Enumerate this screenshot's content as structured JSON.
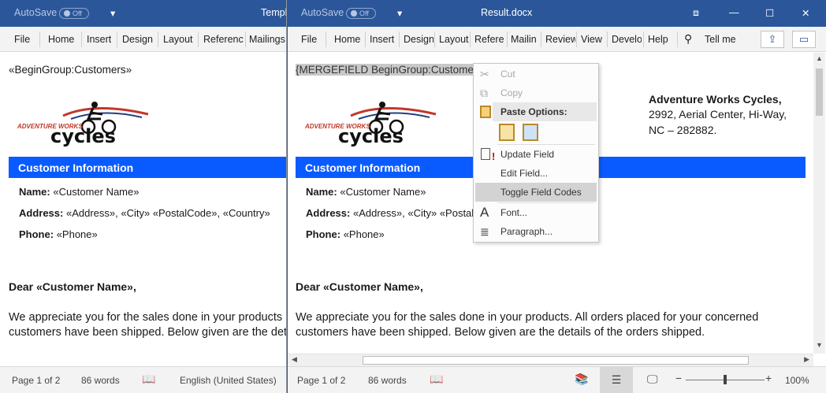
{
  "left_window": {
    "autosave_label": "AutoSave",
    "autosave_state": "Off",
    "title": "Templ",
    "menu": [
      "File",
      "Home",
      "Insert",
      "Design",
      "Layout",
      "Referenc",
      "Mailings"
    ],
    "document": {
      "begin_group": "«BeginGroup:Customers»",
      "logo_top": "ADVENTURE WORKS",
      "logo_bottom": "cycles",
      "section_title": "Customer Information",
      "name_label": "Name:",
      "name_value": "«Customer Name»",
      "address_label": "Address:",
      "address_value": "«Address», «City» «PostalCode», «Country»",
      "phone_label": "Phone:",
      "phone_value": "«Phone»",
      "greeting": "Dear «Customer Name»,",
      "body_line1": "We appreciate you for the sales done in your products",
      "body_line2": "customers have been shipped. Below given are the det"
    },
    "status": {
      "page": "Page 1 of 2",
      "words": "86 words",
      "language": "English (United States)"
    }
  },
  "right_window": {
    "autosave_label": "AutoSave",
    "autosave_state": "Off",
    "title": "Result.docx",
    "menu": [
      "File",
      "Home",
      "Insert",
      "Design",
      "Layout",
      "Refere",
      "Mailin",
      "Review",
      "View",
      "Develo",
      "Help"
    ],
    "tell_me": "Tell me",
    "document": {
      "merge_field": "{MERGEFIELD BeginGroup:Customers",
      "logo_top": "ADVENTURE WORKS",
      "logo_bottom": "cycles",
      "company_name": "Adventure Works Cycles,",
      "company_addr1": "2992, Aerial Center, Hi-Way,",
      "company_addr2": "NC – 282882.",
      "section_title": "Customer Information",
      "name_label": "Name:",
      "name_value": "«Customer Name»",
      "address_label": "Address:",
      "address_value": "«Address», «City» «PostalC",
      "phone_label": "Phone:",
      "phone_value": "«Phone»",
      "greeting": "Dear «Customer Name»,",
      "body_line1": "We appreciate you for the sales done in your products. All orders placed for your concerned",
      "body_line2": "customers have been shipped. Below given are the details of the orders shipped."
    },
    "status": {
      "page": "Page 1 of 2",
      "words": "86 words",
      "zoom": "100%",
      "zoom_level": 100
    }
  },
  "context_menu": {
    "items": [
      {
        "label": "Cut",
        "icon": "scissors-icon",
        "disabled": true
      },
      {
        "label": "Copy",
        "icon": "copy-icon",
        "disabled": true
      },
      {
        "label": "Paste Options:",
        "icon": "paste-icon",
        "section": true
      },
      {
        "label": "Update Field",
        "icon": "update-field-icon"
      },
      {
        "label": "Edit Field...",
        "icon": ""
      },
      {
        "label": "Toggle Field Codes",
        "icon": "",
        "highlighted": true
      },
      {
        "label": "Font...",
        "icon": "font-icon"
      },
      {
        "label": "Paragraph...",
        "icon": "paragraph-icon"
      }
    ]
  },
  "colors": {
    "titlebar": "#2b579a",
    "header_band": "#0a5bff",
    "logo_red": "#c0392b"
  }
}
